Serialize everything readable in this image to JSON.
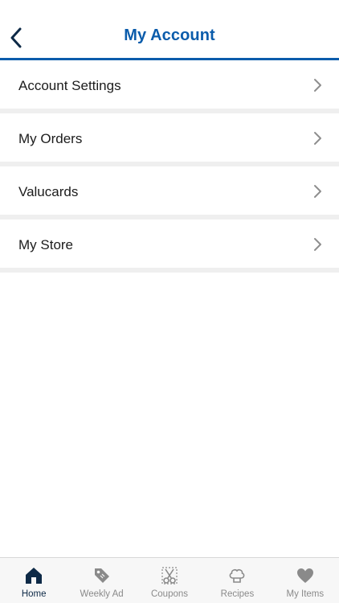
{
  "header": {
    "title": "My Account",
    "back_icon": "chevron-left-icon"
  },
  "menu": {
    "items": [
      {
        "label": "Account Settings",
        "icon": "chevron-right-icon"
      },
      {
        "label": "My Orders",
        "icon": "chevron-right-icon"
      },
      {
        "label": "Valucards",
        "icon": "chevron-right-icon"
      },
      {
        "label": "My Store",
        "icon": "chevron-right-icon"
      }
    ]
  },
  "tabbar": {
    "active": "Home",
    "tabs": [
      {
        "label": "Home",
        "icon": "home-icon"
      },
      {
        "label": "Weekly Ad",
        "icon": "tag-icon"
      },
      {
        "label": "Coupons",
        "icon": "scissors-icon"
      },
      {
        "label": "Recipes",
        "icon": "chef-hat-icon"
      },
      {
        "label": "My Items",
        "icon": "heart-icon"
      }
    ]
  },
  "colors": {
    "brand_blue": "#0b5cab",
    "active_tab": "#0e2a47",
    "inactive_tab": "#8a8a8a",
    "chevron": "#8e8e8e"
  }
}
